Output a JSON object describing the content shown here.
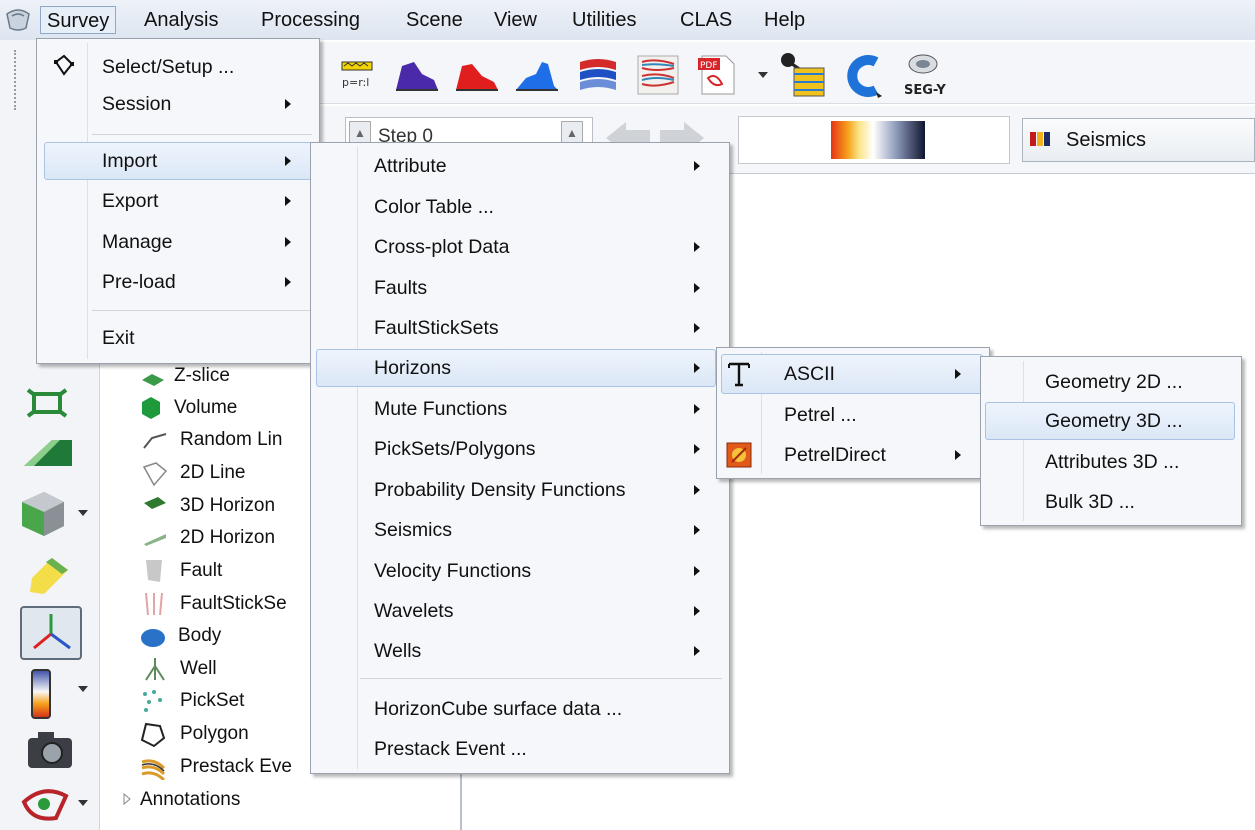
{
  "menubar": {
    "items": [
      "Survey",
      "Analysis",
      "Processing",
      "Scene",
      "View",
      "Utilities",
      "CLAS",
      "Help"
    ]
  },
  "toolbar": {
    "step_label": "Step 0",
    "colortable_name": "Seismics",
    "segy_label": "SEG-Y"
  },
  "survey_menu": {
    "items": [
      {
        "label": "Select/Setup ...",
        "submenu": false
      },
      {
        "label": "Session",
        "submenu": true
      },
      {
        "label": "Import",
        "submenu": true
      },
      {
        "label": "Export",
        "submenu": true
      },
      {
        "label": "Manage",
        "submenu": true
      },
      {
        "label": "Pre-load",
        "submenu": true
      },
      {
        "label": "Exit",
        "submenu": false
      }
    ]
  },
  "import_menu": {
    "items": [
      {
        "label": "Attribute",
        "submenu": true
      },
      {
        "label": "Color Table ...",
        "submenu": false
      },
      {
        "label": "Cross-plot Data",
        "submenu": true
      },
      {
        "label": "Faults",
        "submenu": true
      },
      {
        "label": "FaultStickSets",
        "submenu": true
      },
      {
        "label": "Horizons",
        "submenu": true
      },
      {
        "label": "Mute Functions",
        "submenu": true
      },
      {
        "label": "PickSets/Polygons",
        "submenu": true
      },
      {
        "label": "Probability Density Functions",
        "submenu": true
      },
      {
        "label": "Seismics",
        "submenu": true
      },
      {
        "label": "Velocity Functions",
        "submenu": true
      },
      {
        "label": "Wavelets",
        "submenu": true
      },
      {
        "label": "Wells",
        "submenu": true
      },
      {
        "label": "HorizonCube surface data ...",
        "submenu": false
      },
      {
        "label": "Prestack Event ...",
        "submenu": false
      }
    ]
  },
  "horizons_menu": {
    "items": [
      {
        "label": "ASCII",
        "submenu": true
      },
      {
        "label": "Petrel ...",
        "submenu": false
      },
      {
        "label": "PetrelDirect",
        "submenu": true
      }
    ]
  },
  "ascii_menu": {
    "items": [
      {
        "label": "Geometry 2D ..."
      },
      {
        "label": "Geometry 3D ..."
      },
      {
        "label": "Attributes 3D ..."
      },
      {
        "label": "Bulk 3D ..."
      }
    ]
  },
  "tree": {
    "items": [
      "Z-slice",
      "Volume",
      "Random Lin",
      "2D Line",
      "3D Horizon",
      "2D Horizon",
      "Fault",
      "FaultStickSe",
      "Body",
      "Well",
      "PickSet",
      "Polygon",
      "Prestack Eve"
    ],
    "annotations": "Annotations"
  },
  "colors": {
    "menu_bg": "#f5f7fa",
    "highlight": "#dbe7f6",
    "menubar": "#dde5f0"
  }
}
